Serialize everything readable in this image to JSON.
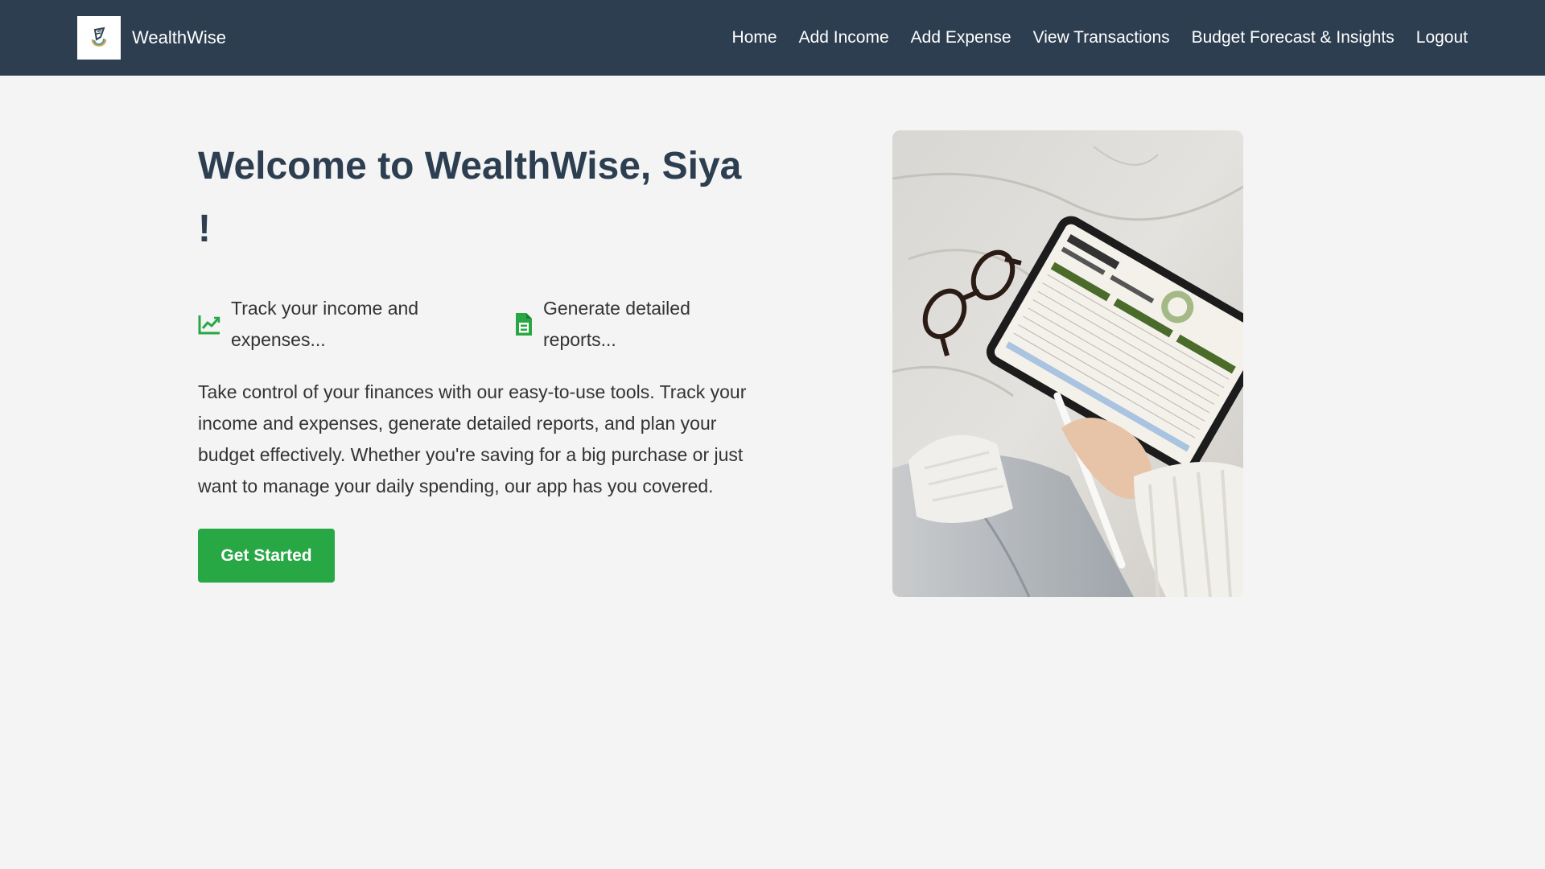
{
  "app": {
    "brand_name": "WealthWise",
    "logo_icon": "wealthwise-logo-icon"
  },
  "nav": {
    "items": [
      {
        "label": "Home"
      },
      {
        "label": "Add Income"
      },
      {
        "label": "Add Expense"
      },
      {
        "label": "View Transactions"
      },
      {
        "label": "Budget Forecast & Insights"
      },
      {
        "label": "Logout"
      }
    ]
  },
  "hero": {
    "title": "Welcome to WealthWise, Siya !",
    "features": [
      {
        "icon": "line-chart-icon",
        "text": "Track your income and expenses..."
      },
      {
        "icon": "document-icon",
        "text": "Generate detailed reports..."
      }
    ],
    "description": "Take control of your finances with our easy-to-use tools. Track your income and expenses, generate detailed reports, and plan your budget effectively. Whether you're saving for a big purchase or just want to manage your daily spending, our app has you covered.",
    "cta_label": "Get Started",
    "image": "photo of glasses and tablet showing budget spreadsheet on bed"
  },
  "colors": {
    "navbar": "#2c3e50",
    "background": "#f4f4f4",
    "accent_green": "#28a745",
    "title": "#2c3e50"
  }
}
